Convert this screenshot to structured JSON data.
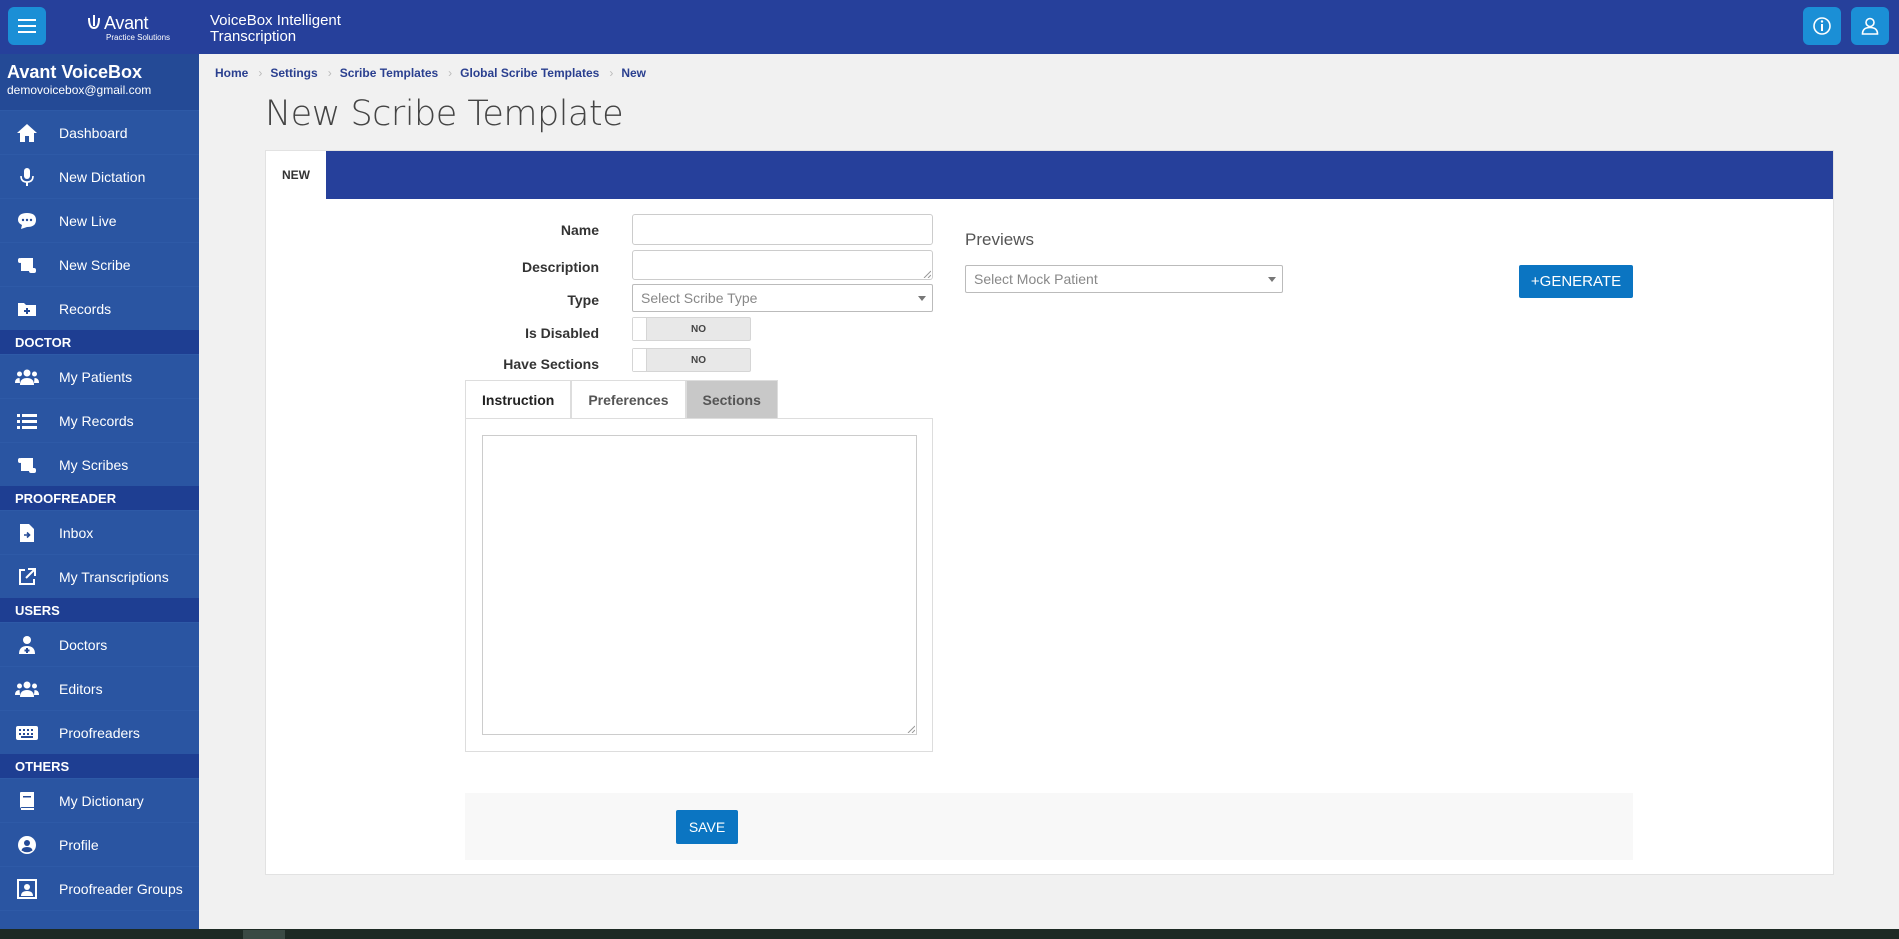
{
  "header": {
    "logo_brand": "Avant",
    "logo_sub": "Practice Solutions",
    "app_title": "VoiceBox Intelligent Transcription",
    "menu_icon": "hamburger-icon",
    "info_icon": "info-icon",
    "user_icon": "user-icon"
  },
  "sidebar": {
    "user_name": "Avant VoiceBox",
    "user_email": "demovoicebox@gmail.com",
    "items_top": [
      {
        "label": "Dashboard",
        "icon": "home-icon"
      },
      {
        "label": "New Dictation",
        "icon": "microphone-icon"
      },
      {
        "label": "New Live",
        "icon": "chat-bubble-icon"
      },
      {
        "label": "New Scribe",
        "icon": "scroll-icon"
      },
      {
        "label": "Records",
        "icon": "folder-plus-icon"
      }
    ],
    "section_doctor": "DOCTOR",
    "items_doctor": [
      {
        "label": "My Patients",
        "icon": "users-icon"
      },
      {
        "label": "My Records",
        "icon": "list-icon"
      },
      {
        "label": "My Scribes",
        "icon": "scroll-icon"
      }
    ],
    "section_proofreader": "PROOFREADER",
    "items_proofreader": [
      {
        "label": "Inbox",
        "icon": "file-import-icon"
      },
      {
        "label": "My Transcriptions",
        "icon": "external-link-icon"
      }
    ],
    "section_users": "USERS",
    "items_users": [
      {
        "label": "Doctors",
        "icon": "doctor-icon"
      },
      {
        "label": "Editors",
        "icon": "users-icon"
      },
      {
        "label": "Proofreaders",
        "icon": "keyboard-icon"
      }
    ],
    "section_others": "OTHERS",
    "items_others": [
      {
        "label": "My Dictionary",
        "icon": "book-icon"
      },
      {
        "label": "Profile",
        "icon": "user-circle-icon"
      },
      {
        "label": "Proofreader Groups",
        "icon": "group-box-icon"
      }
    ]
  },
  "breadcrumb": [
    "Home",
    "Settings",
    "Scribe Templates",
    "Global Scribe Templates",
    "New"
  ],
  "page_title": "New Scribe Template",
  "card": {
    "tab_label": "NEW"
  },
  "form": {
    "name_label": "Name",
    "name_value": "",
    "description_label": "Description",
    "description_value": "",
    "type_label": "Type",
    "type_placeholder": "Select Scribe Type",
    "is_disabled_label": "Is Disabled",
    "is_disabled_value": "NO",
    "have_sections_label": "Have Sections",
    "have_sections_value": "NO",
    "tabs": [
      "Instruction",
      "Preferences",
      "Sections"
    ],
    "instruction_value": ""
  },
  "previews": {
    "label": "Previews",
    "mock_patient_placeholder": "Select Mock Patient",
    "generate_label": "+GENERATE"
  },
  "actions": {
    "save_label": "SAVE"
  },
  "colors": {
    "header": "#26409b",
    "sidebar": "#244a96",
    "accent_button": "#0b75c2",
    "icon_button": "#1b8fd6"
  }
}
